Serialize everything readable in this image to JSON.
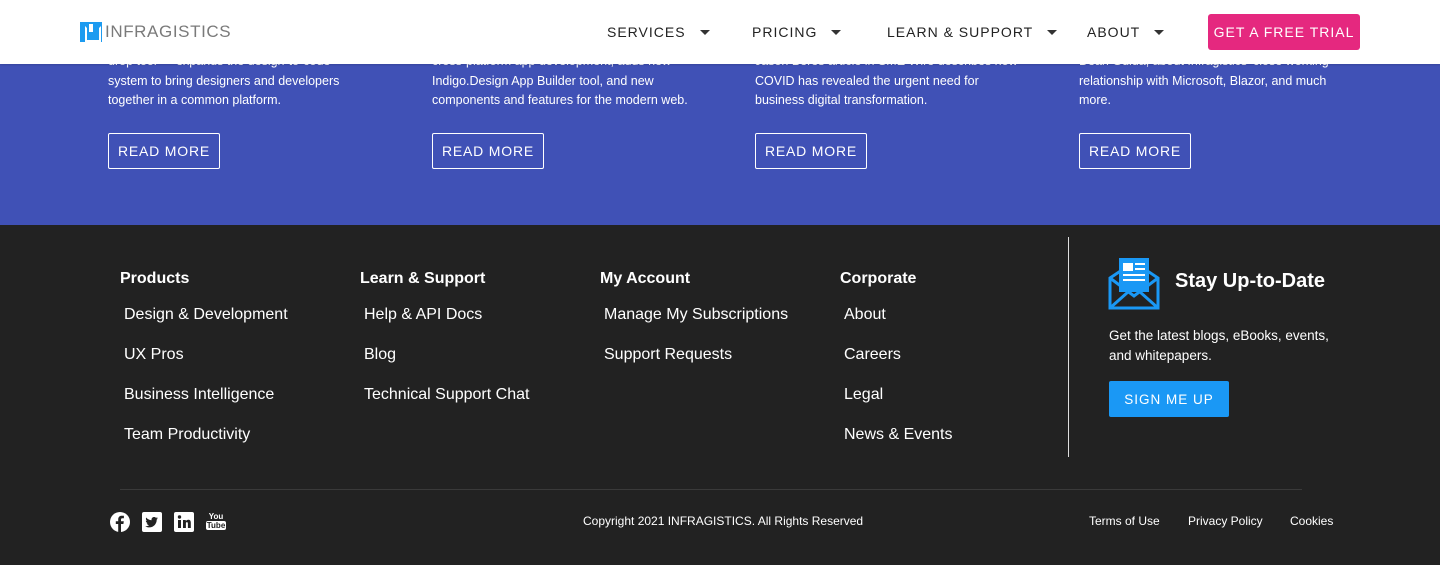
{
  "header": {
    "logo_text": "INFRAGISTICS",
    "nav": [
      "SERVICES",
      "PRICING",
      "LEARN & SUPPORT",
      "ABOUT"
    ],
    "trial_button": "GET A FREE TRIAL"
  },
  "news_cards": [
    {
      "lines": [
        "drop tool — expands the design-to-code",
        "system to bring designers and developers",
        "together in a common platform."
      ],
      "button": "READ MORE"
    },
    {
      "lines": [
        "cross-platform app development, adds new",
        "Indigo.Design App Builder tool, and new",
        "components and features for the modern web."
      ],
      "button": "READ MORE"
    },
    {
      "lines": [
        "Jason Beres article in SME Wire describes how",
        "COVID has revealed the urgent need for",
        "business digital transformation."
      ],
      "button": "READ MORE"
    },
    {
      "lines": [
        "Dean Guida, about Infragistics' close working",
        "relationship with Microsoft, Blazor, and much",
        "more."
      ],
      "button": "READ MORE"
    }
  ],
  "footer": {
    "columns": [
      {
        "title": "Products",
        "links": [
          "Design & Development",
          "UX Pros",
          "Business Intelligence",
          "Team Productivity"
        ]
      },
      {
        "title": "Learn & Support",
        "links": [
          "Help & API Docs",
          "Blog",
          "Technical Support Chat"
        ]
      },
      {
        "title": "My Account",
        "links": [
          "Manage My Subscriptions",
          "Support Requests"
        ]
      },
      {
        "title": "Corporate",
        "links": [
          "About",
          "Careers",
          "Legal",
          "News & Events"
        ]
      }
    ],
    "newsletter": {
      "title": "Stay Up-to-Date",
      "description": "Get the latest blogs, eBooks, events, and whitepapers.",
      "button": "SIGN ME UP"
    },
    "social_icons": [
      "facebook-icon",
      "twitter-icon",
      "linkedin-icon",
      "youtube-icon"
    ],
    "youtube_text": [
      "You",
      "Tube"
    ],
    "copyright": "Copyright 2021 INFRAGISTICS. All Rights Reserved",
    "bottom_links": [
      "Terms of Use",
      "Privacy Policy",
      "Cookies"
    ]
  },
  "colors": {
    "band": "#4051b6",
    "footer_bg": "#222222",
    "trial": "#e5287f",
    "signup": "#1a98f5"
  }
}
